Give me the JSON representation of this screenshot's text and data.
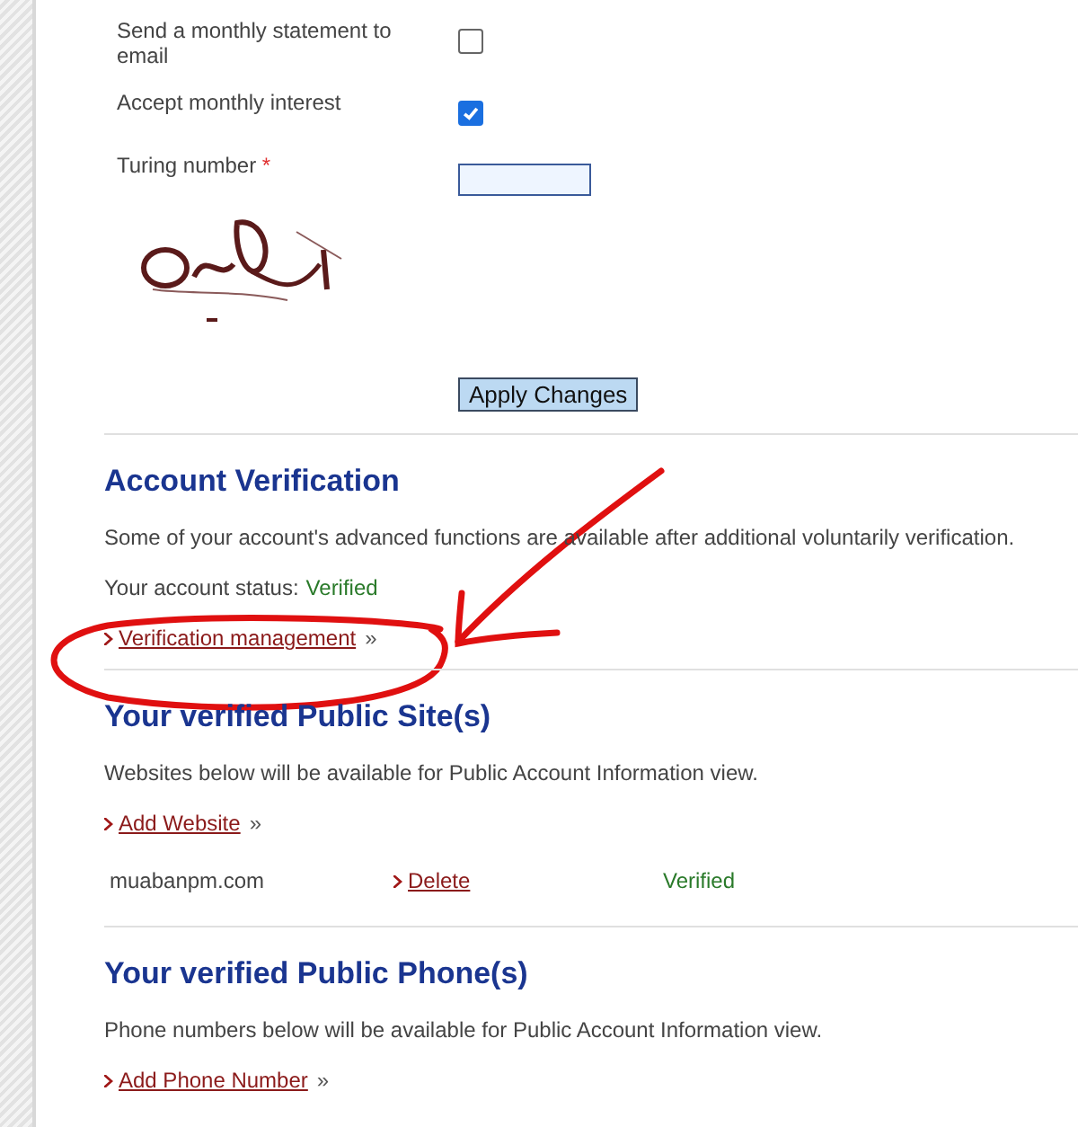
{
  "settings": {
    "rows": [
      {
        "kind": "checkbox",
        "label": "Send a monthly statement to email",
        "checked": false
      },
      {
        "kind": "checkbox",
        "label": "Accept monthly interest",
        "checked": true
      },
      {
        "kind": "input",
        "label": "Turing number",
        "required": true,
        "required_mark": "*"
      }
    ],
    "apply_button": "Apply Changes"
  },
  "account_verification": {
    "title": "Account Verification",
    "description": "Some of your account's advanced functions are available after additional voluntarily verification.",
    "status_label": "Your account status:",
    "status": "Verified",
    "link": {
      "label": "Verification management",
      "arrow": "»"
    }
  },
  "public_sites": {
    "title": "Your verified Public Site(s)",
    "description": "Websites below will be available for Public Account Information view.",
    "link": {
      "label": "Add Website",
      "arrow": "»"
    },
    "rows": [
      {
        "site": "muabanpm.com",
        "action": "Delete",
        "status": "Verified"
      }
    ]
  },
  "public_phones": {
    "title": "Your verified Public Phone(s)",
    "description": "Phone numbers below will be available for Public Account Information view.",
    "link": {
      "label": "Add Phone Number",
      "arrow": "»"
    }
  },
  "annotation": {
    "kind": "circle-arrow"
  }
}
